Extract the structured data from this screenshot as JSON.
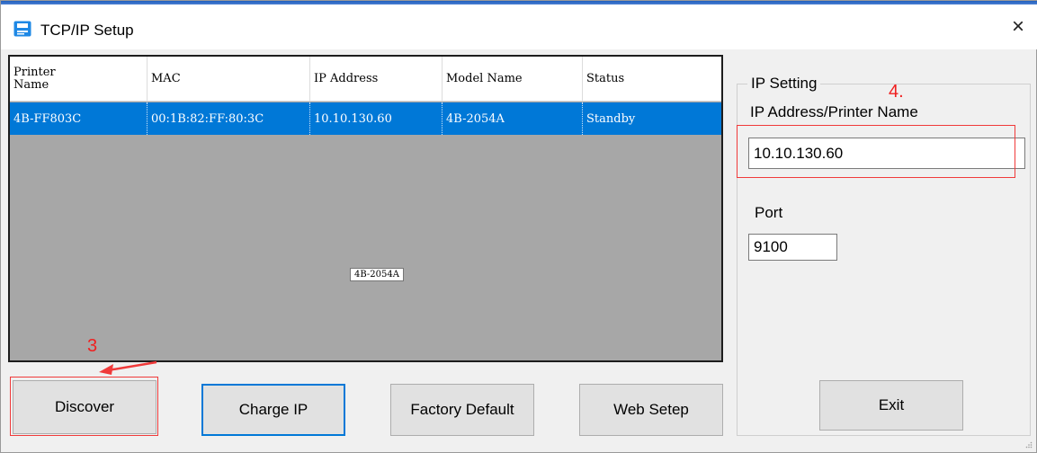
{
  "window": {
    "title": "TCP/IP Setup",
    "close_glyph": "×",
    "icon": "printer-setup-icon"
  },
  "printer_list": {
    "columns": [
      "Printer Name",
      "MAC",
      "IP Address",
      "Model Name",
      "Status"
    ],
    "rows": [
      {
        "name": "4B-FF803C",
        "mac": "00:1B:82:FF:80:3C",
        "ip": "10.10.130.60",
        "model": "4B-2054A",
        "status": "Standby",
        "selected": true
      }
    ],
    "tooltip": "4B-2054A"
  },
  "buttons": {
    "discover": "Discover",
    "charge_ip": "Charge IP",
    "factory_default": "Factory Default",
    "web_setup": "Web Setep",
    "exit": "Exit"
  },
  "ip_setting": {
    "group_label": "IP Setting",
    "address_label": "IP Address/Printer Name",
    "address_value": "10.10.130.60",
    "port_label": "Port",
    "port_value": "9100"
  },
  "annotations": {
    "step_discover": "3",
    "step_ip_address": "4."
  },
  "colors": {
    "selection": "#0078d7",
    "list_background": "#a7a7a7",
    "annotation_red": "#f03a3a",
    "focus_border": "#0078d7"
  }
}
